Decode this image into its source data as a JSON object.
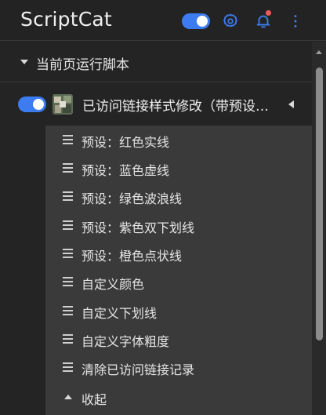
{
  "header": {
    "title": "ScriptCat",
    "enabled": true,
    "icons": [
      "gear-icon",
      "bell-icon",
      "more-vertical-icon"
    ],
    "notification_dot_color": "#f25a5a"
  },
  "section": {
    "title": "当前页运行脚本",
    "expanded": true
  },
  "script": {
    "name": "已访问链接样式修改（带预设…",
    "enabled": true,
    "expanded": true
  },
  "menu": {
    "items": [
      {
        "label": "预设：红色实线"
      },
      {
        "label": "预设：蓝色虚线"
      },
      {
        "label": "预设：绿色波浪线"
      },
      {
        "label": "预设：紫色双下划线"
      },
      {
        "label": "预设：橙色点状线"
      },
      {
        "label": "自定义颜色"
      },
      {
        "label": "自定义下划线"
      },
      {
        "label": "自定义字体粗度"
      },
      {
        "label": "清除已访问链接记录"
      }
    ],
    "collapse_label": "收起"
  },
  "colors": {
    "accent": "#3c7cf0",
    "background": "#242424",
    "menu_background": "#3a3a3a"
  }
}
